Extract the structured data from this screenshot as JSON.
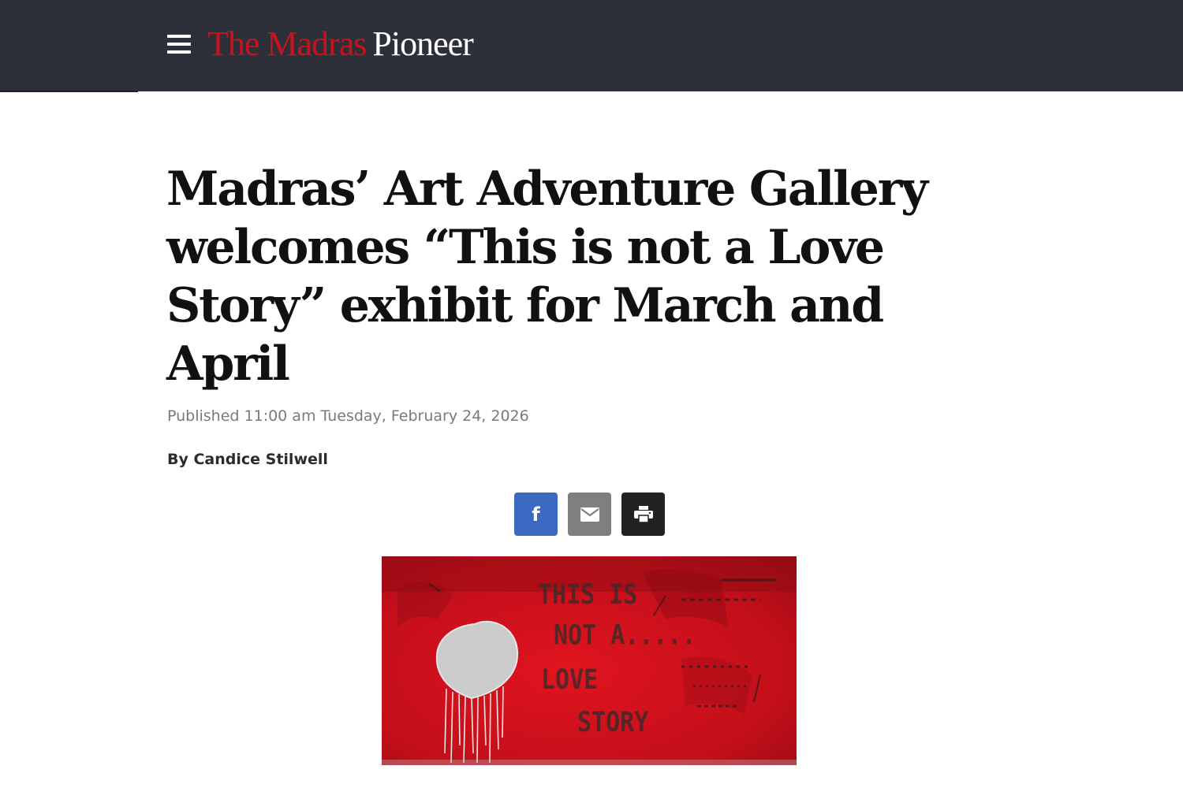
{
  "header": {
    "menu_icon": "hamburger-menu-icon",
    "brand_red": "The Madras",
    "brand_white": "Pioneer",
    "colors": {
      "bar": "#2d3039",
      "brand_red": "#c8121c",
      "brand_white": "#ffffff"
    }
  },
  "article": {
    "headline": "Madras’ Art Adventure Gallery welcomes “This is not a Love Story” exhibit for March and April",
    "published": "Published 11:00 am Tuesday, February 24, 2026",
    "byline": "By Candice Stilwell"
  },
  "share": [
    {
      "icon": "facebook-icon",
      "color": "#3b68c0"
    },
    {
      "icon": "email-icon",
      "color": "#7f7f7f"
    },
    {
      "icon": "print-icon",
      "color": "#222222"
    }
  ],
  "image": {
    "icon": "painting-image",
    "painted_text": [
      "THIS IS",
      "NOT A.....",
      "LOVE",
      "STORY"
    ],
    "colors": {
      "background": "#c8101c",
      "heart": "#c9c9c9"
    }
  }
}
